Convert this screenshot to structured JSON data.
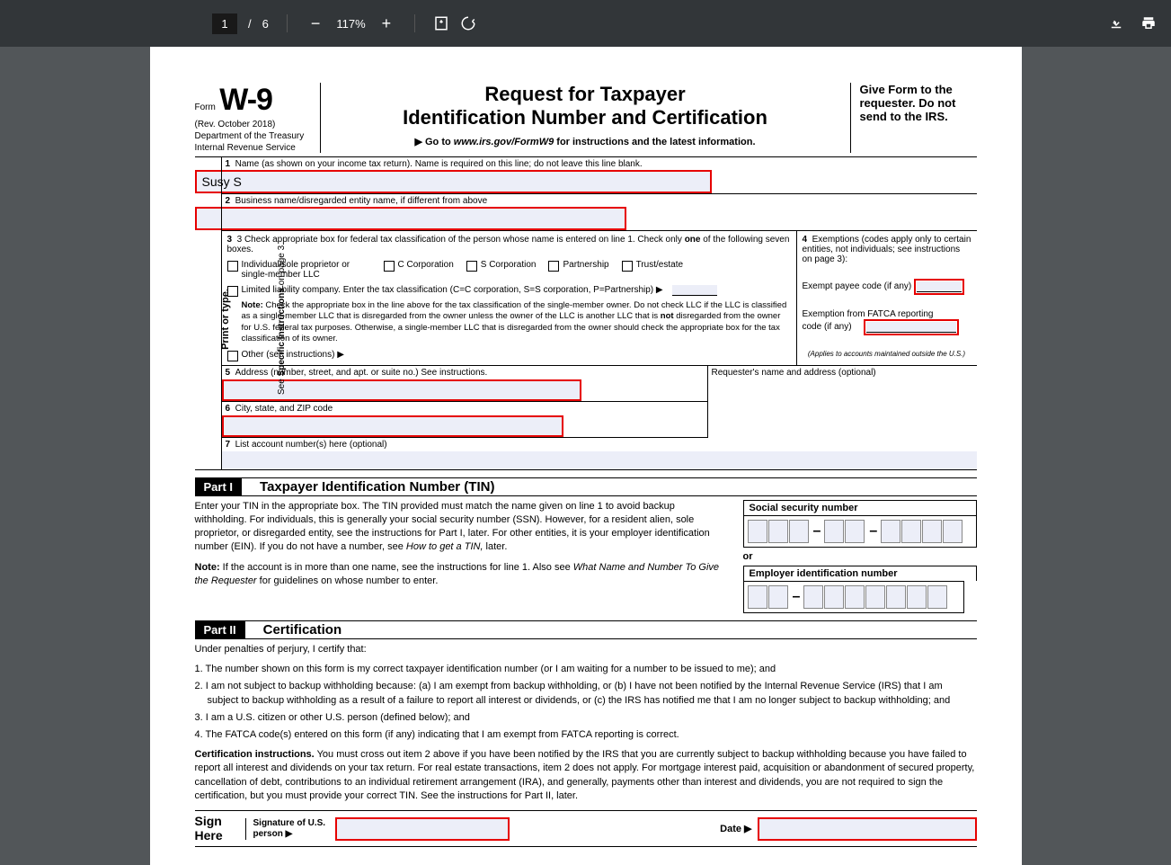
{
  "toolbar": {
    "page_current": "1",
    "page_total": "6",
    "page_sep": "/",
    "zoom": "117%"
  },
  "header": {
    "form_word": "Form",
    "form_code": "W-9",
    "rev": "(Rev. October 2018)",
    "dept1": "Department of the Treasury",
    "dept2": "Internal Revenue Service",
    "title1": "Request for Taxpayer",
    "title2": "Identification Number and Certification",
    "goto_prefix": "▶ Go to ",
    "goto_url": "www.irs.gov/FormW9",
    "goto_suffix": " for instructions and the latest information.",
    "give": "Give Form to the requester. Do not send to the IRS."
  },
  "sidebar": {
    "line1": "Print or type.",
    "line2": "See Specific Instructions on page 3."
  },
  "line1": {
    "label": "1  Name (as shown on your income tax return). Name is required on this line; do not leave this line blank.",
    "value": "Susy S"
  },
  "line2": {
    "label": "2  Business name/disregarded entity name, if different from above",
    "value": ""
  },
  "line3": {
    "label_a": "3  Check appropriate box for federal tax classification of the person whose name is entered on line 1. Check only ",
    "label_b": "one",
    "label_c": " of the following seven boxes.",
    "opt1": "Individual/sole proprietor or single-member LLC",
    "opt2": "C Corporation",
    "opt3": "S Corporation",
    "opt4": "Partnership",
    "opt5": "Trust/estate",
    "llc": "Limited liability company. Enter the tax classification (C=C corporation, S=S corporation, P=Partnership) ▶",
    "note_b": "Note: ",
    "note": "Check the appropriate box in the line above for the tax classification of the single-member owner. Do not check LLC if the LLC is classified as a single-member LLC that is disregarded from the owner unless the owner of the LLC is another LLC that is ",
    "note_not": "not",
    "note2": " disregarded from the owner for U.S. federal tax purposes. Otherwise, a single-member LLC that is disregarded from the owner should check the appropriate box for the tax classification of its owner.",
    "other": "Other (see instructions) ▶"
  },
  "line4": {
    "label": "4  Exemptions (codes apply only to certain entities, not individuals; see instructions on page 3):",
    "exempt_payee": "Exempt payee code (if any)",
    "fatca1": "Exemption from FATCA reporting",
    "fatca2": "code (if any)",
    "applies": "(Applies to accounts maintained outside the U.S.)"
  },
  "line5": {
    "label": "5  Address (number, street, and apt. or suite no.) See instructions."
  },
  "requester": "Requester's name and address (optional)",
  "line6": {
    "label": "6  City, state, and ZIP code"
  },
  "line7": {
    "label": "7  List account number(s) here (optional)"
  },
  "part1": {
    "label": "Part I",
    "title": "Taxpayer Identification Number (TIN)",
    "text1": "Enter your TIN in the appropriate box. The TIN provided must match the name given on line 1 to avoid backup withholding. For individuals, this is generally your social security number (SSN). However, for a resident alien, sole proprietor, or disregarded entity, see the instructions for Part I, later. For other entities, it is your employer identification number (EIN). If you do not have a number, see ",
    "text1_i": "How to get a TIN,",
    "text1_end": " later.",
    "note_b": "Note:",
    "note": " If the account is in more than one name, see the instructions for line 1. Also see ",
    "note_i": "What Name and Number To Give the Requester",
    "note_end": " for guidelines on whose number to enter.",
    "ssn_label": "Social security number",
    "or": "or",
    "ein_label": "Employer identification number"
  },
  "part2": {
    "label": "Part II",
    "title": "Certification",
    "perjury": "Under penalties of perjury, I certify that:",
    "item1": "1. The number shown on this form is my correct taxpayer identification number (or I am waiting for a number to be issued to me); and",
    "item2": "2. I am not subject to backup withholding because: (a) I am exempt from backup withholding, or (b) I have not been notified by the Internal Revenue Service (IRS) that I am subject to backup withholding as a result of a failure to report all interest or dividends, or (c) the IRS has notified me that I am no longer subject to backup withholding; and",
    "item3": "3. I am a U.S. citizen or other U.S. person (defined below); and",
    "item4": "4. The FATCA code(s) entered on this form (if any) indicating that I am exempt from FATCA reporting is correct.",
    "cert_b": "Certification instructions.",
    "cert": " You must cross out item 2 above if you have been notified by the IRS that you are currently subject to backup withholding because you have failed to report all interest and dividends on your tax return. For real estate transactions, item 2 does not apply. For mortgage interest paid, acquisition or abandonment of secured property, cancellation of debt, contributions to an individual retirement arrangement (IRA), and generally, payments other than interest and dividends, you are not required to sign the certification, but you must provide your correct TIN. See the instructions for Part II, later."
  },
  "sign": {
    "here": "Sign Here",
    "sig_label": "Signature of U.S. person ▶",
    "date": "Date ▶"
  }
}
